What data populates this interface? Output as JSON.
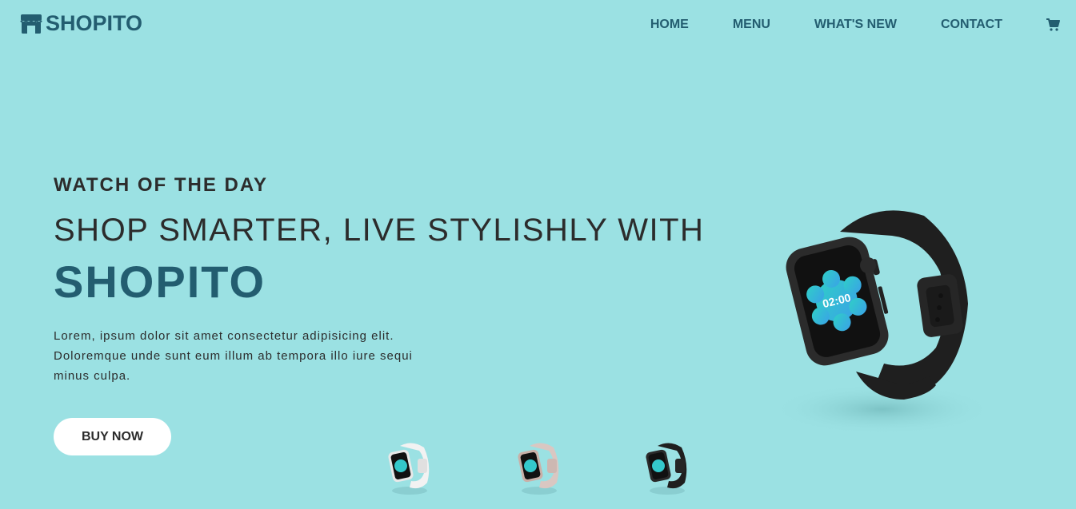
{
  "header": {
    "brand": "SHOPITO",
    "nav": [
      {
        "label": "HOME"
      },
      {
        "label": "MENU"
      },
      {
        "label": "WHAT'S NEW"
      },
      {
        "label": "CONTACT"
      }
    ],
    "cart_icon": "cart-icon",
    "logo_icon": "store-icon"
  },
  "hero": {
    "eyebrow": "WATCH OF THE DAY",
    "headline": "SHOP SMARTER, LIVE STYLISHLY WITH",
    "brand_word": "SHOPITO",
    "description": "Lorem, ipsum dolor sit amet consectetur adipisicing elit. Doloremque unde sunt eum illum ab tempora illo iure sequi minus culpa.",
    "cta_label": "BUY NOW",
    "main_watch": {
      "screen_time": "02:00",
      "band_color": "#1f1f1f"
    }
  },
  "thumbnails": [
    {
      "variant": "white",
      "band_color": "#f2f2f2",
      "case_color": "#e8e8e8"
    },
    {
      "variant": "rose",
      "band_color": "#d9c7c2",
      "case_color": "#c9b0a8"
    },
    {
      "variant": "black",
      "band_color": "#1f1f1f",
      "case_color": "#2a2a2a"
    }
  ],
  "colors": {
    "background": "#9be1e3",
    "accent": "#235d70",
    "text": "#2c2c2c",
    "button_bg": "#ffffff"
  }
}
